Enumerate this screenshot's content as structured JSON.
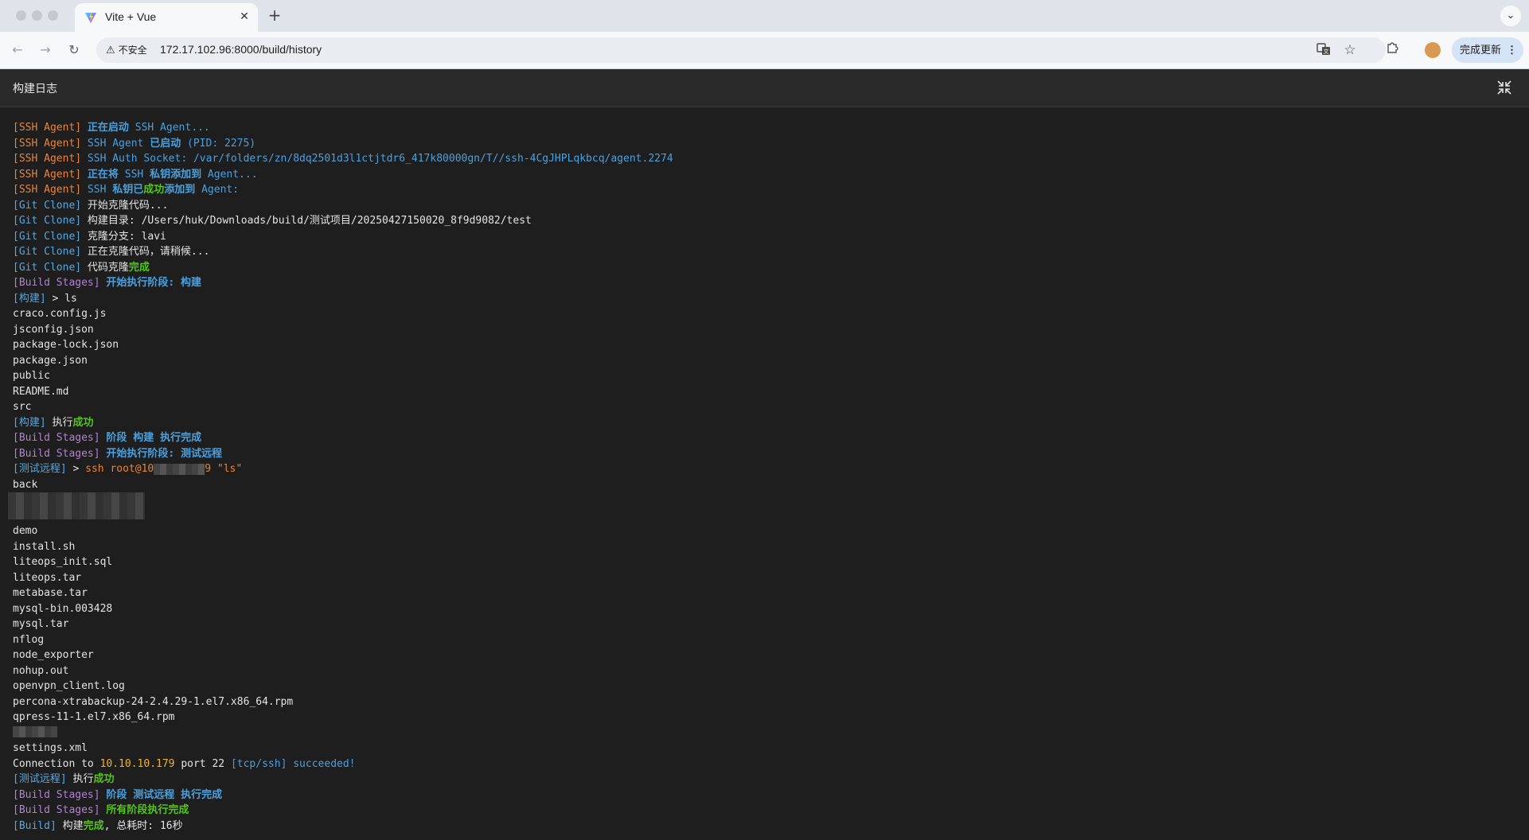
{
  "browser": {
    "tab_title": "Vite + Vue",
    "insecure_label": "不安全",
    "url": "172.17.102.96:8000/build/history",
    "update_label": "完成更新"
  },
  "page": {
    "title": "构建日志"
  },
  "log": {
    "l1": [
      "[SSH Agent]",
      " 正在启动",
      " SSH Agent..."
    ],
    "l2": [
      "[SSH Agent]",
      " SSH Agent ",
      "已启动",
      " (PID: 2275)"
    ],
    "l3": [
      "[SSH Agent]",
      " SSH Auth Socket: /var/folders/zn/8dq2501d3l1ctjtdr6_417k80000gn/T//ssh-4CgJHPLqkbcq/agent.2274"
    ],
    "l4": [
      "[SSH Agent]",
      " 正在将",
      " SSH ",
      "私钥添加到",
      " Agent..."
    ],
    "l5": [
      "[SSH Agent]",
      " SSH ",
      "私钥已",
      "成功",
      "添加到",
      " Agent:"
    ],
    "l6": [
      "[Git Clone]",
      " 开始克隆代码..."
    ],
    "l7": [
      "[Git Clone]",
      " 构建目录: /Users/huk/Downloads/build/测试项目/20250427150020_8f9d9082/test"
    ],
    "l8": [
      "[Git Clone]",
      " 克隆分支: lavi"
    ],
    "l9": [
      "[Git Clone]",
      " 正在克隆代码，请稍候..."
    ],
    "l10": [
      "[Git Clone]",
      " 代码克隆",
      "完成"
    ],
    "l11": [
      "[Build Stages]",
      " 开始执行阶段: 构建"
    ],
    "l12": [
      "[构建]",
      " > ls"
    ],
    "files1": [
      "craco.config.js",
      "jsconfig.json",
      "package-lock.json",
      "package.json",
      "public",
      "README.md",
      "src"
    ],
    "l13": [
      "[构建]",
      " 执行",
      "成功"
    ],
    "l14": [
      "[Build Stages]",
      " 阶段 ",
      "构建",
      " 执行完成"
    ],
    "l15": [
      "[Build Stages]",
      " 开始执行阶段: 测试远程"
    ],
    "l16": [
      "[测试远程]",
      " > ",
      "ssh root@10",
      "9 \"ls\""
    ],
    "files2a": [
      "back"
    ],
    "files2b": [
      "demo",
      "install.sh",
      "liteops_init.sql",
      "liteops.tar",
      "metabase.tar",
      "mysql-bin.003428",
      "mysql.tar",
      "nflog",
      "node_exporter",
      "nohup.out",
      "openvpn_client.log",
      "percona-xtrabackup-24-2.4.29-1.el7.x86_64.rpm",
      "qpress-11-1.el7.x86_64.rpm"
    ],
    "files2c": [
      "settings.xml"
    ],
    "l17": [
      "Connection to ",
      "10.10.10.179",
      " port 22 ",
      "[tcp/ssh]",
      " succeeded!"
    ],
    "l18": [
      "[测试远程]",
      " 执行",
      "成功"
    ],
    "l19": [
      "[Build Stages]",
      " 阶段 ",
      "测试远程",
      " 执行完成"
    ],
    "l20": [
      "[Build Stages]",
      " 所有阶段执行完成"
    ],
    "l21": [
      "[Build]",
      " 构建",
      "完成",
      ", 总耗时: 16秒"
    ]
  }
}
